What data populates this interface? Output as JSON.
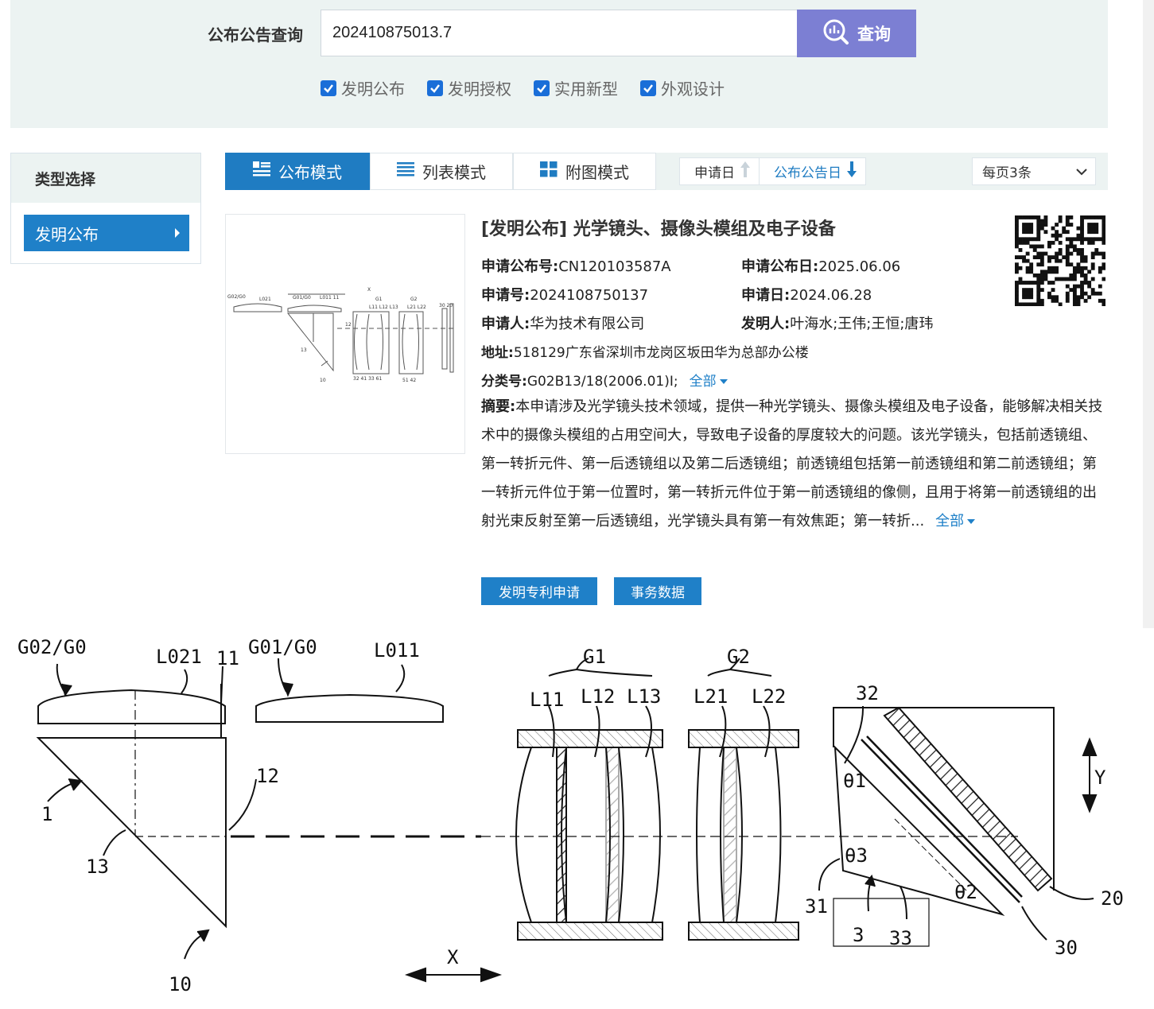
{
  "search": {
    "label": "公布公告查询",
    "value": "202410875013.7",
    "button_label": "查询"
  },
  "filters": [
    {
      "label": "发明公布",
      "checked": true
    },
    {
      "label": "发明授权",
      "checked": true
    },
    {
      "label": "实用新型",
      "checked": true
    },
    {
      "label": "外观设计",
      "checked": true
    }
  ],
  "sidebar": {
    "title": "类型选择",
    "items": [
      {
        "label": "发明公布",
        "active": true
      }
    ]
  },
  "toolbar": {
    "tabs": [
      {
        "label": "公布模式",
        "active": true
      },
      {
        "label": "列表模式",
        "active": false
      },
      {
        "label": "附图模式",
        "active": false
      }
    ],
    "sort": [
      {
        "label": "申请日",
        "direction": "up",
        "active": false
      },
      {
        "label": "公布公告日",
        "direction": "down",
        "active": true
      }
    ],
    "per_page": "每页3条"
  },
  "record": {
    "title": "[发明公布] 光学镜头、摄像头模组及电子设备",
    "pub_no_label": "申请公布号:",
    "pub_no": "CN120103587A",
    "pub_date_label": "申请公布日:",
    "pub_date": "2025.06.06",
    "app_no_label": "申请号:",
    "app_no": "2024108750137",
    "app_date_label": "申请日:",
    "app_date": "2024.06.28",
    "applicant_label": "申请人:",
    "applicant": "华为技术有限公司",
    "inventor_label": "发明人:",
    "inventors": "叶海水;王伟;王恒;唐玮",
    "address_label": "地址:",
    "address": "518129广东省深圳市龙岗区坂田华为总部办公楼",
    "class_label": "分类号:",
    "class_no": "G02B13/18(2006.01)I;",
    "all_label": "全部",
    "abstract_label": "摘要:",
    "abstract": "本申请涉及光学镜头技术领域，提供一种光学镜头、摄像头模组及电子设备，能够解决相关技术中的摄像头模组的占用空间大，导致电子设备的厚度较大的问题。该光学镜头，包括前透镜组、第一转折元件、第一后透镜组以及第二后透镜组；前透镜组包括第一前透镜组和第二前透镜组；第一转折元件位于第一位置时，第一转折元件位于第一前透镜组的像侧，且用于将第一前透镜组的出射光束反射至第一后透镜组，光学镜头具有第一有效焦距；第一转折...",
    "abstract_more": "全部",
    "buttons": [
      "发明专利申请",
      "事务数据"
    ]
  },
  "drawing": {
    "labels": [
      "G02/G0",
      "L021",
      "11",
      "G01/G0",
      "L011",
      "G1",
      "L11",
      "L12",
      "L13",
      "G2",
      "L21",
      "L22",
      "32",
      "θ1",
      "Y",
      "12",
      "1",
      "13",
      "θ3",
      "31",
      "θ2",
      "20",
      "3",
      "33",
      "30",
      "X",
      "10"
    ]
  }
}
